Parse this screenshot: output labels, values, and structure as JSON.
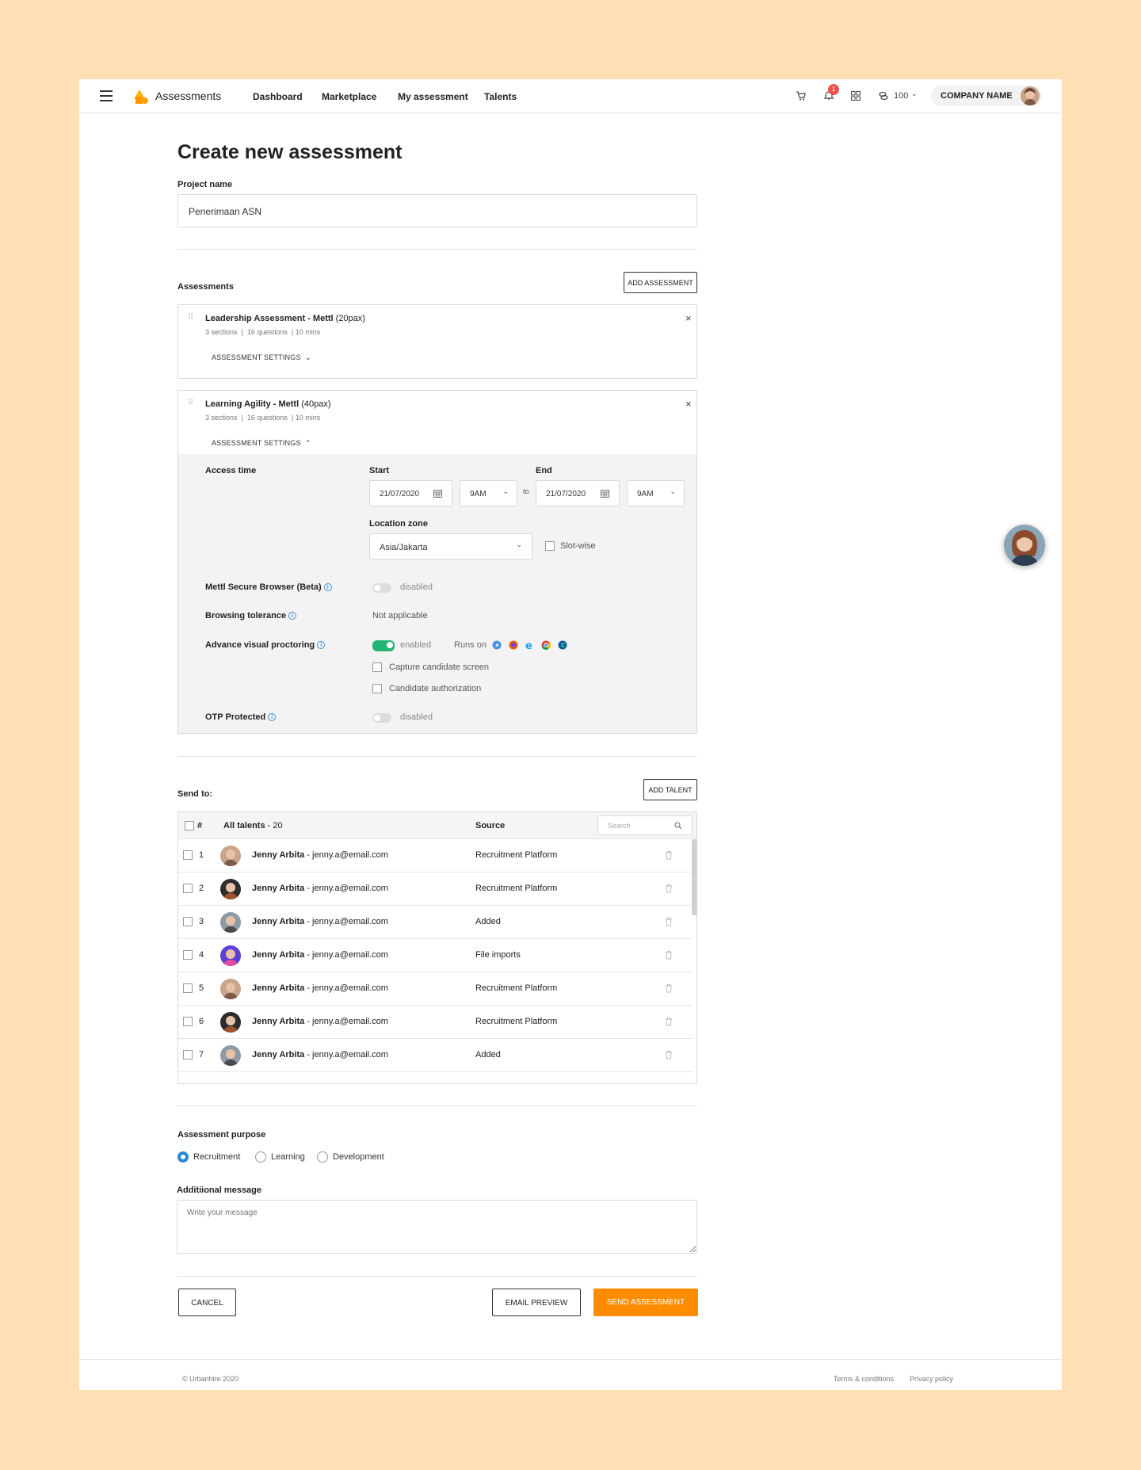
{
  "nav": {
    "app_title": "Assessments",
    "links": [
      "Dashboard",
      "Marketplace",
      "My assessment",
      "Talents"
    ],
    "notification_count": "1",
    "credits": "100",
    "company": "COMPANY NAME"
  },
  "page": {
    "title": "Create new assessment",
    "project_label": "Project name",
    "project_value": "Penerimaan ASN",
    "assessments_label": "Assessments",
    "add_assessment": "ADD ASSESSMENT"
  },
  "assessments": [
    {
      "name": "Leadership Assessment - Mettl",
      "pax": "(20pax)",
      "sections": "3 sections",
      "questions": "16 questions",
      "mins": "10 mins",
      "settings": "ASSESSMENT SETTINGS"
    },
    {
      "name": "Learning Agility - Mettl",
      "pax": "(40pax)",
      "sections": "3 sections",
      "questions": "16 questions",
      "mins": "10 mins",
      "settings": "ASSESSMENT SETTINGS"
    }
  ],
  "settings": {
    "access_time": "Access time",
    "start": "Start",
    "end": "End",
    "start_date": "21/07/2020",
    "start_time": "9AM",
    "to": "to",
    "end_date": "21/07/2020",
    "end_time": "9AM",
    "location_label": "Location zone",
    "location_value": "Asia/Jakarta",
    "slot_wise": "Slot-wise",
    "secure_browser": "Mettl Secure Browser (Beta)",
    "secure_browser_state": "disabled",
    "browsing_tolerance": "Browsing tolerance",
    "browsing_tolerance_value": "Not applicable",
    "proctoring": "Advance visual proctoring",
    "proctoring_state": "enabled",
    "runs_on": "Runs on",
    "capture_screen": "Capture candidate screen",
    "candidate_auth": "Candidate authorization",
    "otp": "OTP Protected",
    "otp_state": "disabled"
  },
  "send": {
    "label": "Send to:",
    "add_talent": "ADD TALENT",
    "hash": "#",
    "all_talents": "All talents",
    "count": "- 20",
    "source": "Source",
    "search_placeholder": "Search"
  },
  "talents": [
    {
      "num": "1",
      "name": "Jenny Arbita",
      "email": "- jenny.a@email.com",
      "source": "Recruitment Platform"
    },
    {
      "num": "2",
      "name": "Jenny Arbita",
      "email": "- jenny.a@email.com",
      "source": "Recruitment Platform"
    },
    {
      "num": "3",
      "name": "Jenny Arbita",
      "email": "- jenny.a@email.com",
      "source": "Added"
    },
    {
      "num": "4",
      "name": "Jenny Arbita",
      "email": "- jenny.a@email.com",
      "source": "File imports"
    },
    {
      "num": "5",
      "name": "Jenny Arbita",
      "email": "- jenny.a@email.com",
      "source": "Recruitment Platform"
    },
    {
      "num": "6",
      "name": "Jenny Arbita",
      "email": "- jenny.a@email.com",
      "source": "Recruitment Platform"
    },
    {
      "num": "7",
      "name": "Jenny Arbita",
      "email": "- jenny.a@email.com",
      "source": "Added"
    }
  ],
  "purpose": {
    "label": "Assessment purpose",
    "options": [
      "Recruitment",
      "Learning",
      "Development"
    ],
    "selected": "Recruitment"
  },
  "message": {
    "label": "Additiional message",
    "placeholder": "Write your message"
  },
  "actions": {
    "cancel": "CANCEL",
    "preview": "EMAIL PREVIEW",
    "send": "SEND ASSESSMENT"
  },
  "footer": {
    "copyright": "© Urbanhire 2020",
    "terms": "Terms & conditions",
    "privacy": "Privacy policy"
  },
  "colors": {
    "accent": "#ff8c00",
    "enabled": "#22b573",
    "info": "#3b8fd6",
    "badge": "#ef5350",
    "background": "#ffe0b5"
  }
}
